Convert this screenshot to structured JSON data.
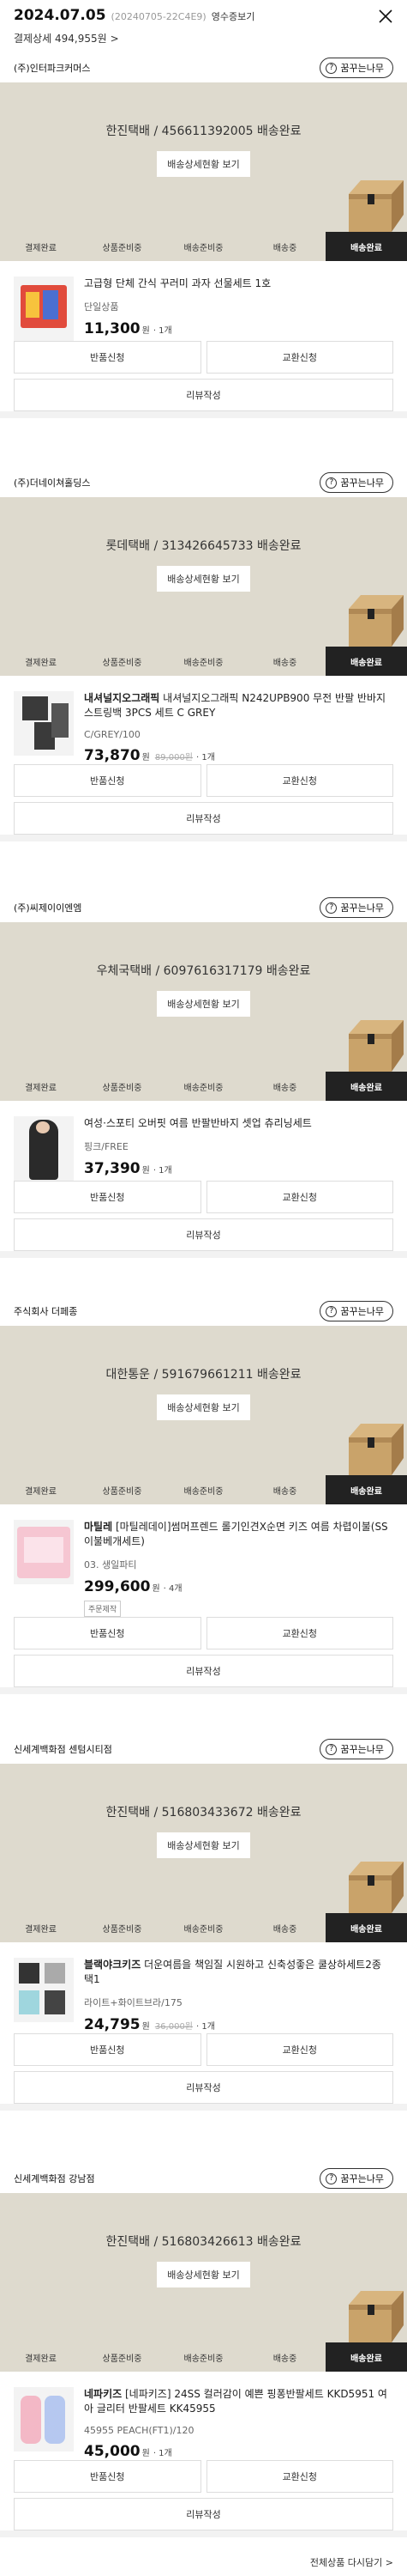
{
  "header": {
    "date": "2024.07.05",
    "order_no": "(20240705-22C4E9)",
    "receipt_label": "영수증보기",
    "payment_label": "결제상세 494,955원",
    "chevron": ">"
  },
  "common": {
    "who_label": "꿈꾸는나무",
    "detail_button": "배송상세현황 보기",
    "steps": [
      "결제완료",
      "상품준비중",
      "배송준비중",
      "배송중",
      "배송완료"
    ],
    "return_label": "반품신청",
    "exchange_label": "교환신청",
    "review_label": "리뷰작성"
  },
  "sellers": [
    {
      "name": "(주)인터파크커머스",
      "tracking": "한진택배 / 456611392005 배송완료",
      "product": {
        "brand": "",
        "name": "고급형 단체 간식 꾸러미 과자 선물세트 1호",
        "option": "단일상품",
        "price": "11,300",
        "won": "원",
        "original": "",
        "qty": "· 1개",
        "badge": ""
      }
    },
    {
      "name": "(주)더네이쳐홀딩스",
      "tracking": "롯데택배 / 313426645733 배송완료",
      "product": {
        "brand": "내셔널지오그래픽",
        "name": "내셔널지오그래픽 N242UPB900 무전 반팔 반바지 스트링백 3PCS 세트 C GREY",
        "option": "C/GREY/100",
        "price": "73,870",
        "won": "원",
        "original": "89,000원",
        "qty": "· 1개",
        "badge": ""
      }
    },
    {
      "name": "(주)씨제이이엔엠",
      "tracking": "우체국택배 / 6097616317179 배송완료",
      "product": {
        "brand": "",
        "name": "여성·스포티 오버핏 여름 반팔반바지 셋업 츄리닝세트",
        "option": "핑크/FREE",
        "price": "37,390",
        "won": "원",
        "original": "",
        "qty": "· 1개",
        "badge": ""
      }
    },
    {
      "name": "주식회사 더페종",
      "tracking": "대한통운 / 591679661211 배송완료",
      "product": {
        "brand": "마틸레",
        "name": "[마틸레데이]썸머프렌드 롤기인견X순면 키즈 여름 차렵이불(SS 이불베개세트)",
        "option": "03. 생일파티",
        "price": "299,600",
        "won": "원",
        "original": "",
        "qty": "· 4개",
        "badge": "주문제작"
      }
    },
    {
      "name": "신세계백화점 센텀시티점",
      "tracking": "한진택배 / 516803433672 배송완료",
      "product": {
        "brand": "블랙야크키즈",
        "name": "더운여름을 책임질 시원하고 신축성좋은 쿨상하세트2종 택1",
        "option": "라이트+화이트브라/175",
        "price": "24,795",
        "won": "원",
        "original": "36,000원",
        "qty": "· 1개",
        "badge": ""
      }
    },
    {
      "name": "신세계백화점 강남점",
      "tracking": "한진택배 / 516803426613 배송완료",
      "product": {
        "brand": "네파키즈",
        "name": "[네파키즈] 24SS 컬러감이 예쁜 핑퐁반팔세트 KKD5951 여아 글리터 반팔세트 KK45955",
        "option": "45955 PEACH(FT1)/120",
        "price": "45,000",
        "won": "원",
        "original": "",
        "qty": "· 1개",
        "badge": ""
      }
    }
  ],
  "footer": {
    "all_products": "전체상품 다시담기 >"
  }
}
